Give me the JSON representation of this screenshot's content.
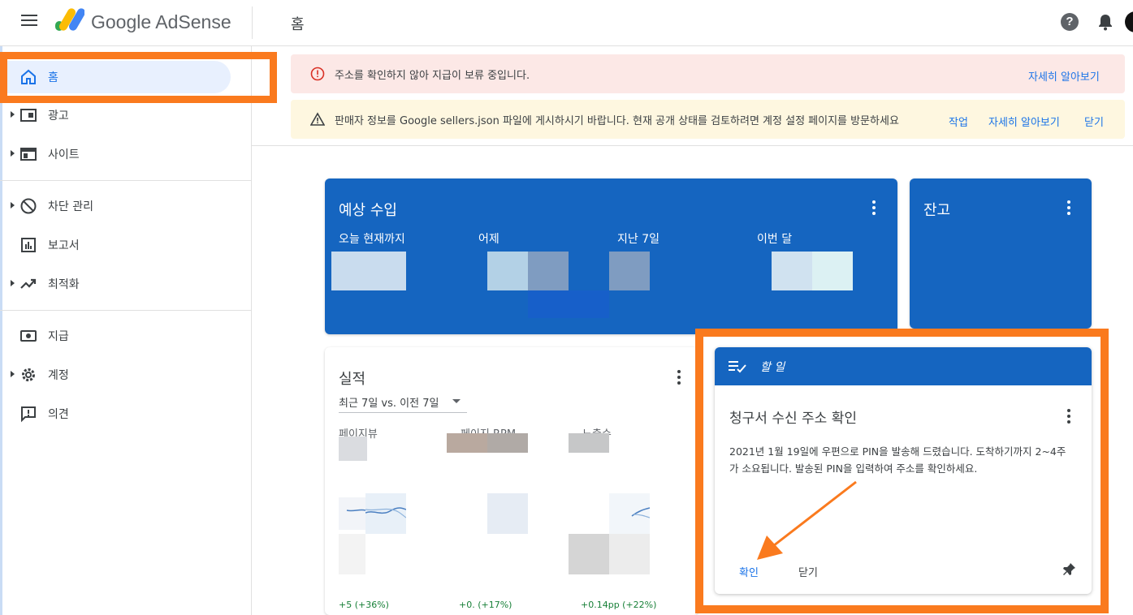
{
  "header": {
    "brand": "Google AdSense",
    "page_title": "홈",
    "help_glyph": "?"
  },
  "sidebar": {
    "items": [
      {
        "label": "홈",
        "icon": "home-icon",
        "active": true
      },
      {
        "label": "광고",
        "icon": "ads-icon"
      },
      {
        "label": "사이트",
        "icon": "sites-icon"
      },
      {
        "label": "차단 관리",
        "icon": "block-icon"
      },
      {
        "label": "보고서",
        "icon": "report-icon"
      },
      {
        "label": "최적화",
        "icon": "trending-icon"
      },
      {
        "label": "지급",
        "icon": "payments-icon"
      },
      {
        "label": "계정",
        "icon": "gear-icon"
      },
      {
        "label": "의견",
        "icon": "feedback-icon"
      }
    ]
  },
  "banners": {
    "error": {
      "text": "주소를 확인하지 않아 지급이 보류 중입니다.",
      "link": "자세히 알아보기"
    },
    "warning": {
      "text": "판매자 정보를 Google sellers.json 파일에 게시하시기 바랍니다. 현재 공개 상태를 검토하려면 계정 설정 페이지를 방문하세요",
      "action": "작업",
      "link": "자세히 알아보기",
      "dismiss": "닫기"
    }
  },
  "earnings": {
    "title": "예상 수입",
    "metrics": [
      "오늘 현재까지",
      "어제",
      "지난 7일",
      "이번 달"
    ]
  },
  "balance": {
    "title": "잔고"
  },
  "performance": {
    "title": "실적",
    "range": "최근 7일 vs. 이전 7일",
    "metrics": [
      {
        "label": "페이지뷰",
        "change": "+5 (+36%)"
      },
      {
        "label": "페이지 RPM",
        "change": "+0.      (+17%)"
      },
      {
        "label": "노출수",
        "change": "+0.14pp (+22%)"
      }
    ]
  },
  "task": {
    "header": "할 일",
    "title": "청구서 수신 주소 확인",
    "body": "2021년 1월 19일에 우편으로 PIN을 발송해 드렸습니다. 도착하기까지 2~4주가 소요됩니다. 발송된 PIN을 입력하여 주소를 확인하세요.",
    "confirm": "확인",
    "close": "닫기"
  },
  "colors": {
    "primary": "#1565c0",
    "accent": "#1a73e8",
    "highlight": "#fa7a1e",
    "error_bg": "#fce8e6",
    "warning_bg": "#fef7e0"
  }
}
